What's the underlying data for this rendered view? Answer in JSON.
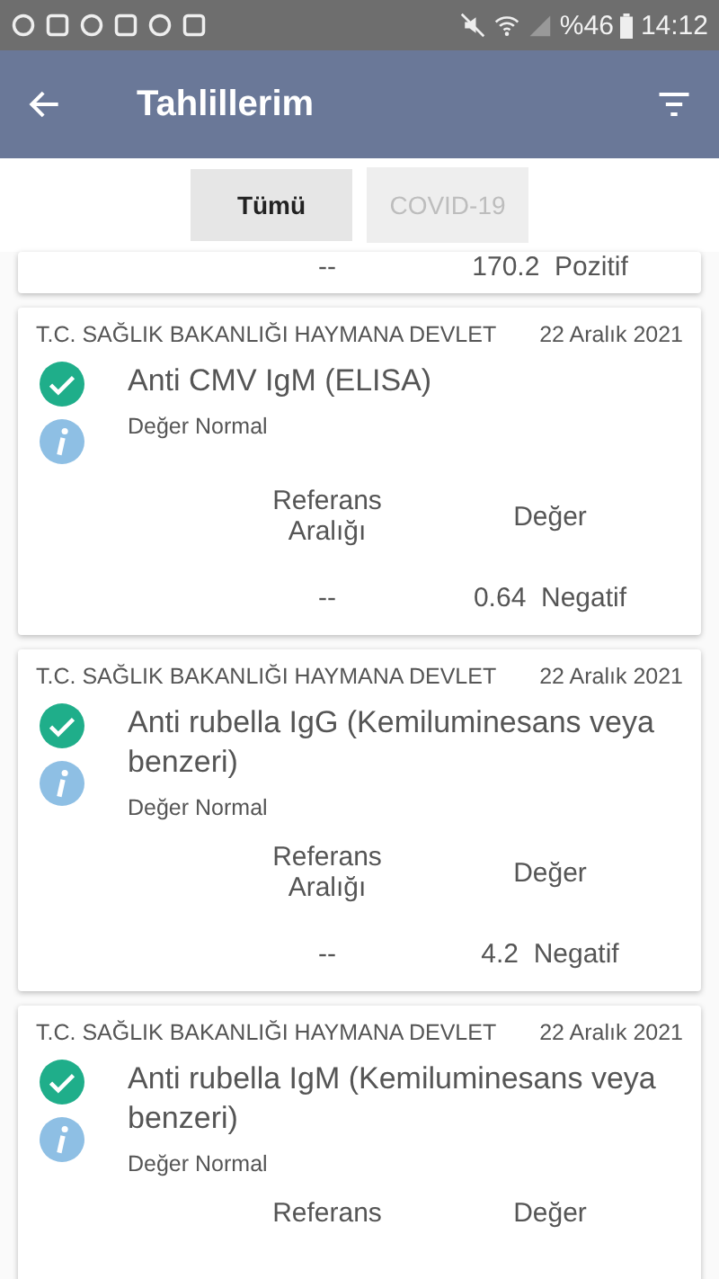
{
  "status_bar": {
    "battery": "%46",
    "time": "14:12"
  },
  "app_bar": {
    "title": "Tahlillerim"
  },
  "tabs": [
    {
      "label": "Tümü",
      "selected": true
    },
    {
      "label": "COVID-19",
      "selected": false
    }
  ],
  "partial_card": {
    "reference": "--",
    "value": "170.2",
    "result": "Pozitif"
  },
  "cards": [
    {
      "institution": "T.C. SAĞLIK BAKANLIĞI HAYMANA DEVLET",
      "date": "22 Aralık 2021",
      "test": "Anti CMV IgM (ELISA)",
      "note": "Değer Normal",
      "ref_header": "Referans Aralığı",
      "value_header": "Değer",
      "reference": "--",
      "value": "0.64",
      "result": "Negatif"
    },
    {
      "institution": "T.C. SAĞLIK BAKANLIĞI HAYMANA DEVLET",
      "date": "22 Aralık 2021",
      "test": "Anti rubella IgG (Kemiluminesans veya benzeri)",
      "note": "Değer Normal",
      "ref_header": "Referans Aralığı",
      "value_header": "Değer",
      "reference": "--",
      "value": "4.2",
      "result": "Negatif"
    },
    {
      "institution": "T.C. SAĞLIK BAKANLIĞI HAYMANA DEVLET",
      "date": "22 Aralık 2021",
      "test": "Anti rubella IgM (Kemiluminesans veya benzeri)",
      "note": "Değer Normal",
      "ref_header": "Referans",
      "value_header": "Değer"
    }
  ]
}
